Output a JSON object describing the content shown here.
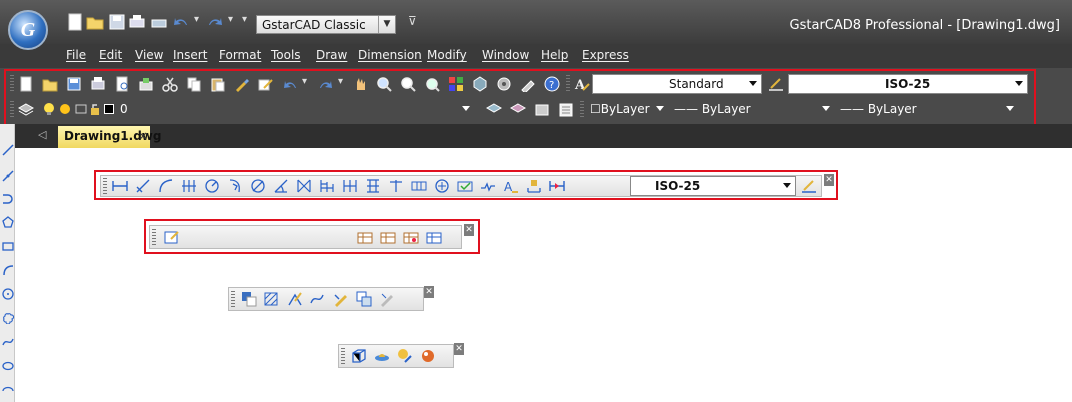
{
  "title_bar": {
    "app_button_letter": "G",
    "workspace_selector": "GstarCAD Classic",
    "window_title": "GstarCAD8 Professional - [Drawing1.dwg]",
    "quick_access_icons": [
      "new-icon",
      "open-icon",
      "save-icon",
      "plot-icon",
      "undo-icon",
      "redo-icon"
    ]
  },
  "menu_bar": [
    "File",
    "Edit",
    "View",
    "Insert",
    "Format",
    "Tools",
    "Draw",
    "Dimension",
    "Modify",
    "Window",
    "Help",
    "Express"
  ],
  "standard_toolbar": {
    "text_style": "Standard",
    "dim_style": "ISO-25"
  },
  "layers_toolbar": {
    "current_layer": "0",
    "color": "☐ByLayer",
    "linetype": "—— ByLayer",
    "lineweight": "—— ByLayer"
  },
  "document_tabs": [
    {
      "label": "Drawing1.dwg",
      "close": "×",
      "active": true
    }
  ],
  "dimension_toolbar": {
    "dim_style": "ISO-25"
  },
  "colors": {
    "highlight_border": "#e0101e",
    "active_tab": "#f7e27a",
    "dark_chrome": "#3c3c3c"
  }
}
